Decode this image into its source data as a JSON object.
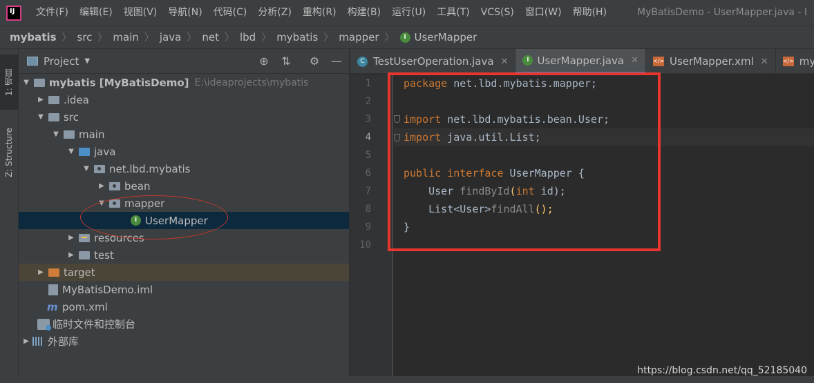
{
  "menubar": {
    "logo": "IJ",
    "items": [
      "文件(F)",
      "编辑(E)",
      "视图(V)",
      "导航(N)",
      "代码(C)",
      "分析(Z)",
      "重构(R)",
      "构建(B)",
      "运行(U)",
      "工具(T)",
      "VCS(S)",
      "窗口(W)",
      "帮助(H)"
    ],
    "window_title": "MyBatisDemo - UserMapper.java - I"
  },
  "breadcrumb": {
    "items": [
      "mybatis",
      "src",
      "main",
      "java",
      "net",
      "lbd",
      "mybatis",
      "mapper"
    ],
    "current": "UserMapper"
  },
  "toolstrip": {
    "project_tab": "1: 项目",
    "structure_tab": "Z: Structure"
  },
  "project_panel": {
    "title": "Project",
    "tree": [
      {
        "label": "mybatis [MyBatisDemo]",
        "path": "E:\\ideaprojects\\mybatis"
      },
      {
        "label": ".idea"
      },
      {
        "label": "src"
      },
      {
        "label": "main"
      },
      {
        "label": "java"
      },
      {
        "label": "net.lbd.mybatis"
      },
      {
        "label": "bean"
      },
      {
        "label": "mapper"
      },
      {
        "label": "UserMapper"
      },
      {
        "label": "resources"
      },
      {
        "label": "test"
      },
      {
        "label": "target"
      },
      {
        "label": "MyBatisDemo.iml"
      },
      {
        "label": "pom.xml"
      },
      {
        "label": "临时文件和控制台"
      },
      {
        "label": "外部库"
      }
    ]
  },
  "editor": {
    "tabs": [
      "TestUserOperation.java",
      "UserMapper.java",
      "UserMapper.xml",
      "myba"
    ],
    "active_tab": 1,
    "line_numbers": [
      "1",
      "2",
      "3",
      "4",
      "5",
      "6",
      "7",
      "8",
      "9",
      "10"
    ],
    "current_line": 4,
    "code": {
      "l1_kw": "package",
      "l1_rest": " net.lbd.mybatis.mapper;",
      "l3_kw": "import",
      "l3_rest": " net.lbd.mybatis.bean.User;",
      "l4_kw": "import",
      "l4_rest": " java.util.List;",
      "l6_kw1": "public",
      "l6_kw2": "interface",
      "l6_rest": " UserMapper {",
      "l7_type": "    User ",
      "l7_fn": "findById",
      "l7_p1": "(",
      "l7_kw": "int",
      "l7_p2": " id);",
      "l8_type": "    List<User>",
      "l8_fn": "findAll",
      "l8_p": "();",
      "l9": "}"
    }
  },
  "watermark": "https://blog.csdn.net/qq_52185040",
  "colors": {
    "keyword": "#cc7832",
    "method": "#ffc66d",
    "text": "#a9b7c6",
    "highlight_box": "#e8362e",
    "interface_icon": "#4a8c3f"
  }
}
